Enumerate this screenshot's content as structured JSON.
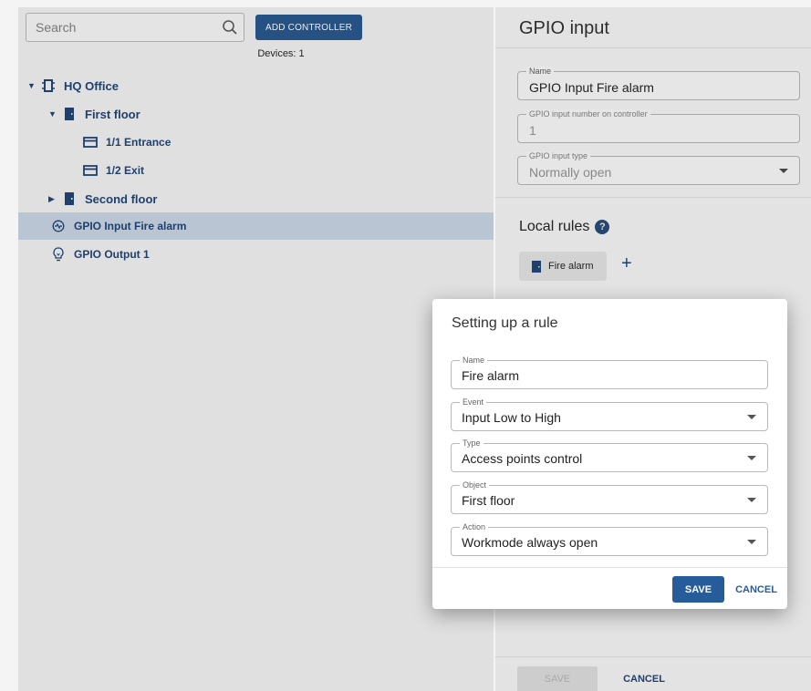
{
  "left_panel": {
    "search": {
      "placeholder": "Search"
    },
    "add_button": "ADD CONTROLLER",
    "devices_count": "Devices: 1",
    "tree": [
      {
        "label": "HQ Office",
        "icon": "controller-icon",
        "expanded": true
      },
      {
        "label": "First floor",
        "icon": "door-icon",
        "expanded": true
      },
      {
        "label": "1/1 Entrance",
        "icon": "access-point-icon"
      },
      {
        "label": "1/2 Exit",
        "icon": "access-point-icon"
      },
      {
        "label": "Second floor",
        "icon": "door-icon",
        "expanded": false
      },
      {
        "label": "GPIO Input Fire alarm",
        "icon": "gpio-input-icon",
        "selected": true
      },
      {
        "label": "GPIO Output 1",
        "icon": "bulb-icon"
      }
    ]
  },
  "right_panel": {
    "title": "GPIO input",
    "fields": {
      "name": {
        "label": "Name",
        "value": "GPIO Input Fire alarm"
      },
      "input_number": {
        "label": "GPIO input number on controller",
        "value": "1"
      },
      "input_type": {
        "label": "GPIO input type",
        "value": "Normally open"
      }
    },
    "local_rules_title": "Local rules",
    "help_glyph": "?",
    "rule_chip": "Fire alarm",
    "add_glyph": "+",
    "save_label": "SAVE",
    "cancel_label": "CANCEL"
  },
  "dialog": {
    "title": "Setting up a rule",
    "fields": {
      "name": {
        "label": "Name",
        "value": "Fire alarm"
      },
      "event": {
        "label": "Event",
        "value": "Input Low to High"
      },
      "type": {
        "label": "Type",
        "value": "Access points control"
      },
      "object": {
        "label": "Object",
        "value": "First floor"
      },
      "action": {
        "label": "Action",
        "value": "Workmode always open"
      }
    },
    "save_label": "SAVE",
    "cancel_label": "CANCEL"
  },
  "colors": {
    "primary": "#275c9b",
    "tree_text": "#1f3f6d",
    "selection": "#b9c5d2"
  }
}
